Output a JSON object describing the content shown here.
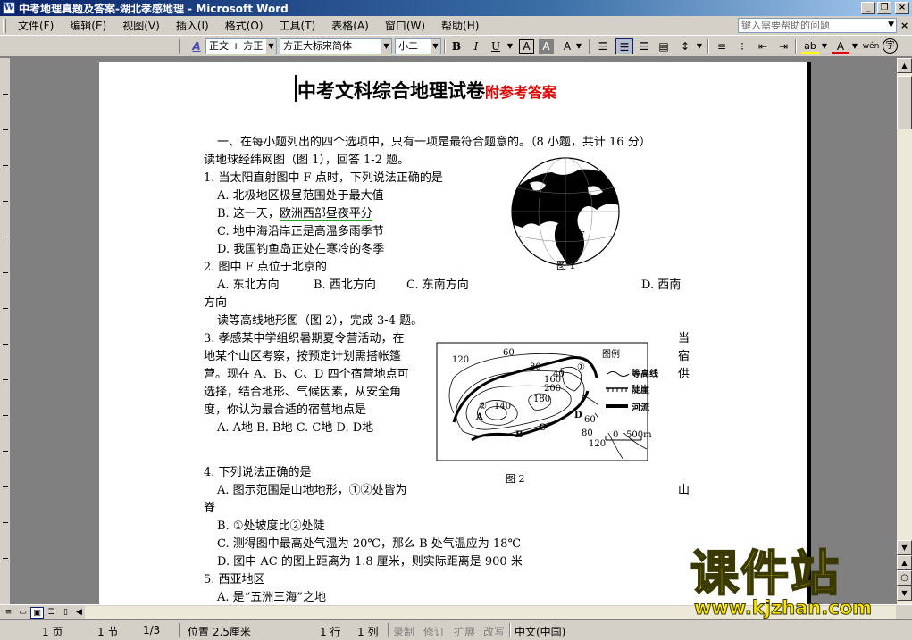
{
  "window": {
    "title": "中考地理真题及答案-湖北孝感地理 - Microsoft Word",
    "icon_letter": "W",
    "minimize": "_",
    "maximize": "❐",
    "close": "×"
  },
  "menu": {
    "items": [
      "文件(F)",
      "编辑(E)",
      "视图(V)",
      "插入(I)",
      "格式(O)",
      "工具(T)",
      "表格(A)",
      "窗口(W)",
      "帮助(H)"
    ],
    "help_placeholder": "键入需要帮助的问题",
    "doc_close": "×"
  },
  "toolbar": {
    "style_icon": "A",
    "style_value": "正文 + 方正",
    "font_value": "方正大标宋简体",
    "size_value": "小二",
    "bold": "B",
    "italic": "I",
    "underline": "U",
    "char_border": "A",
    "char_shade": "A",
    "scale": "A",
    "highlight": "ab",
    "font_color": "A",
    "phonetic": "wén",
    "enclose": "字",
    "icons": [
      "align-justify-icon",
      "align-center-icon",
      "align-right-icon",
      "distributed-icon",
      "line-spacing-icon",
      "numbering-icon",
      "bullets-icon",
      "decrease-indent-icon",
      "increase-indent-icon"
    ]
  },
  "document": {
    "title_main": "中考文科综合地理试卷",
    "title_sub": "附参考答案",
    "section1": "一、在每小题列出的四个选项中，只有一项是最符合题意的。（8 小题，共计 16 分）",
    "read1": "读地球经纬网图（图 1），回答 1-2 题。",
    "q1": "1. 当太阳直射图中 F 点时，下列说法正确的是",
    "q1a": "A. 北极地区极昼范围处于最大值",
    "q1b_pre": "B. 这一天，",
    "q1b_ul": "欧洲西部昼夜平分",
    "q1c": "C. 地中海沿岸正是高温多雨季节",
    "q1d": "D. 我国钓鱼岛正处在寒冷的冬季",
    "q2": "2. 图中 F 点位于北京的",
    "q2a": "A. 东北方向",
    "q2b": "B. 西北方向",
    "q2c": "C. 东南方向",
    "q2d": "D. 西南",
    "q2d_cont": "方向",
    "read2": "读等高线地形图（图 2），完成 3-4 题。",
    "q3_l1": "3. 孝感某中学组织暑期夏令营活动，在",
    "q3_r1": "当",
    "q3_l2": "地某个山区考察，按预定计划需搭帐篷",
    "q3_r2": "宿",
    "q3_l3": "营。现在 A、B、C、D 四个宿营地点可",
    "q3_r3": "供",
    "q3_l4": "选择，结合地形、气候因素，从安全角",
    "q3_l5": "度，你认为最合适的宿营地点是",
    "q3_opts": "A. A地  B. B地  C. C地  D. D地",
    "q4": "4. 下列说法正确的是",
    "q4a": "A. 图示范围是山地地形，①②处皆为",
    "q4a_r": "山",
    "q4a_cont": "脊",
    "q4b": "B. ①处坡度比②处陡",
    "q4c": "C. 测得图中最高处气温为 20℃，那么 B 处气温应为 18℃",
    "q4d": "D. 图中 AC 的图上距离为 1.8 厘米，则实际距离是 900 米",
    "q5": "5. 西亚地区",
    "q5a": "A. 是“五洲三海”之地"
  },
  "figure1": {
    "caption": "图 1",
    "label_f": "F"
  },
  "figure2": {
    "caption": "图 2",
    "legend_title": "图例",
    "legend_contour": "等高线",
    "legend_cliff": "陡崖",
    "legend_river": "河流",
    "scale_zero": "0",
    "scale_len": "500m",
    "contour_labels": [
      "120",
      "60",
      "80",
      "40",
      "200",
      "160",
      "180",
      "140",
      "60",
      "80",
      "120"
    ],
    "points": [
      "A",
      "B",
      "C",
      "D"
    ],
    "marks": [
      "①",
      "②"
    ]
  },
  "statusbar": {
    "page": "1 页",
    "section": "1 节",
    "pages": "1/3",
    "position": "位置 2.5厘米",
    "line": "1 行",
    "col": "1 列",
    "rec": "录制",
    "trk": "修订",
    "ext": "扩展",
    "ovr": "改写",
    "lang": "中文(中国)"
  },
  "watermark": {
    "title": "课件站",
    "url": "www.kjzhan.com"
  }
}
